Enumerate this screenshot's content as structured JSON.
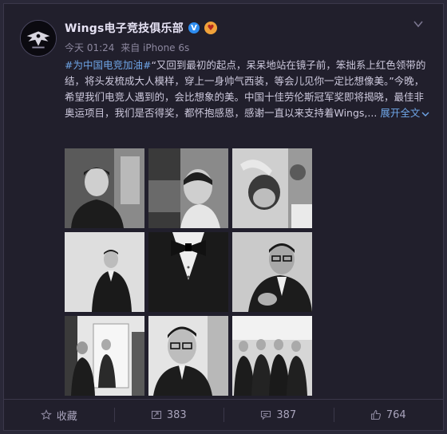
{
  "post": {
    "author": "Wings电子竞技俱乐部",
    "verified_badge": "V",
    "time": "今天 01:24",
    "source": "来自 iPhone 6s",
    "hashtag": "#为中国电竞加油#",
    "text": "“又回到最初的起点，呆呆地站在镜子前，笨拙系上红色领带的结，将头发梳成大人模样，穿上一身帅气西装，等会儿见你一定比想像美。”今晚，希望我们电竞人遇到的，会比想象的美。中国十佳劳伦斯冠军奖即将揭晓，最佳非奥运项目，我们是否得奖，都怀抱感恩，感谢一直以来支持着Wings,...",
    "expand_label": "展开全文",
    "expand_icon": "chevron-down-icon",
    "menu_icon": "chevron-down-icon"
  },
  "photos": [
    {
      "name": "barber-chair-portrait"
    },
    {
      "name": "haircut-back-view"
    },
    {
      "name": "hair-styling"
    },
    {
      "name": "suit-portrait-standing"
    },
    {
      "name": "bowtie-closeup"
    },
    {
      "name": "glasses-suit-portrait"
    },
    {
      "name": "mirror-group"
    },
    {
      "name": "glasses-closeup"
    },
    {
      "name": "group-in-suits"
    }
  ],
  "footer": {
    "favorite_label": "收藏",
    "repost_count": "383",
    "comment_count": "387",
    "like_count": "764"
  },
  "colors": {
    "background": "#211f2c",
    "link": "#6fa6e8",
    "verified": "#2d8cf0"
  }
}
